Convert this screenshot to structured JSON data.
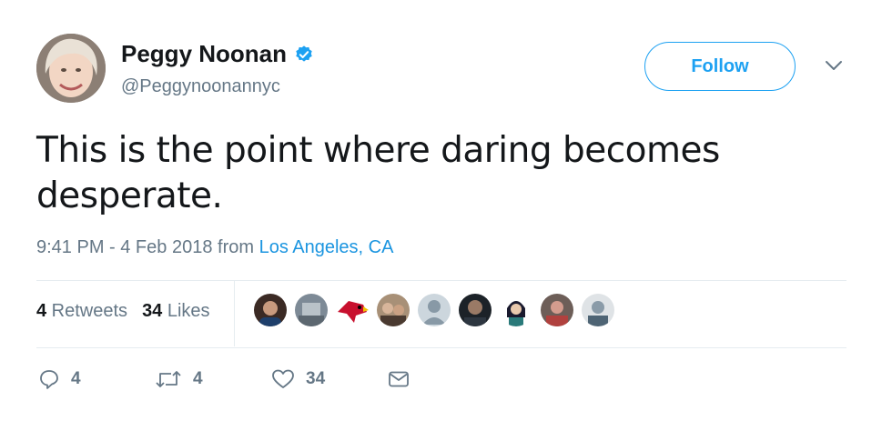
{
  "tweet": {
    "author_name": "Peggy Noonan",
    "author_handle": "@Peggynoonannyc",
    "follow_label": "Follow",
    "text": "This is the point where daring becomes desperate.",
    "timestamp": "9:41 PM - 4 Feb 2018",
    "from_label": " from ",
    "location": "Los Angeles, CA"
  },
  "stats": {
    "retweets_count": "4",
    "retweets_label": " Retweets",
    "likes_count": "34",
    "likes_label": " Likes"
  },
  "actions": {
    "reply_count": "4",
    "retweet_count": "4",
    "like_count": "34"
  },
  "colors": {
    "accent": "#1da1f2",
    "link": "#1b95e0",
    "secondary_text": "#657786",
    "divider": "#e6ecf0"
  },
  "icons": [
    "verified-badge-icon",
    "chevron-down-icon",
    "reply-icon",
    "retweet-icon",
    "heart-icon",
    "message-icon"
  ]
}
